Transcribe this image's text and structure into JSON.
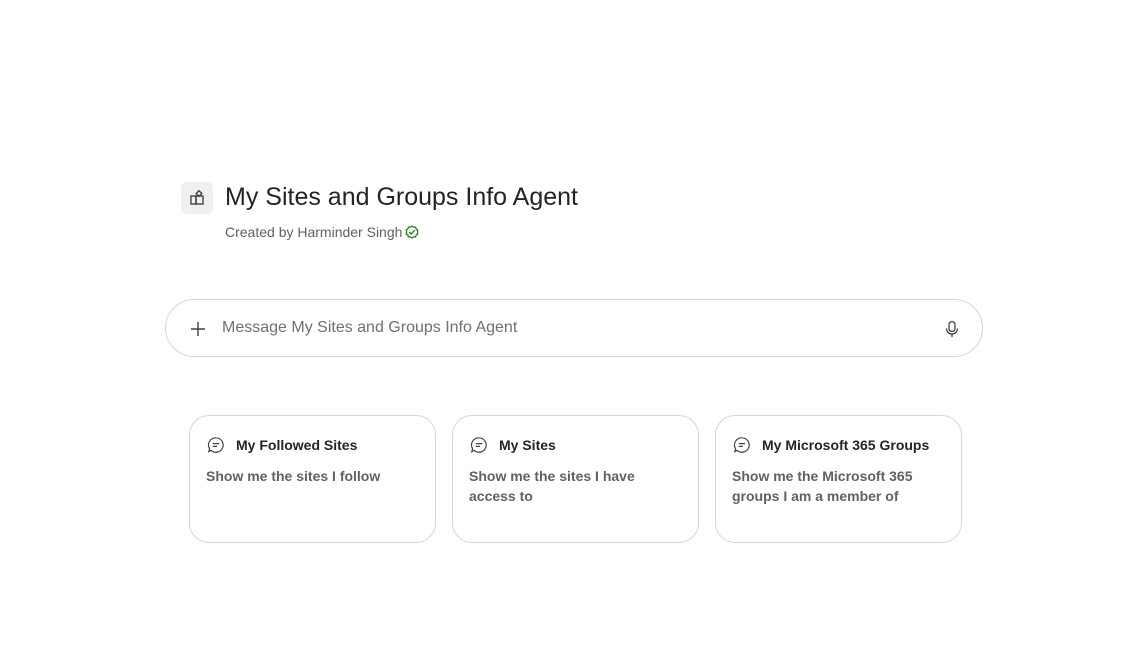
{
  "agent": {
    "title": "My Sites and Groups Info Agent",
    "created_by": "Created by Harminder Singh",
    "icon": "agent-app-icon",
    "verified_icon": "verified-check-icon",
    "verified_color": "#107c10"
  },
  "composer": {
    "placeholder": "Message My Sites and Groups Info Agent",
    "value": "",
    "add_icon": "plus-icon",
    "mic_icon": "microphone-icon"
  },
  "suggestions": [
    {
      "icon": "chat-bubble-icon",
      "title": "My Followed Sites",
      "prompt": "Show me the sites I follow"
    },
    {
      "icon": "chat-bubble-icon",
      "title": "My Sites",
      "prompt": "Show me the sites I have access to"
    },
    {
      "icon": "chat-bubble-icon",
      "title": "My Microsoft 365 Groups",
      "prompt": "Show me the Microsoft 365 groups I am a member of"
    }
  ]
}
